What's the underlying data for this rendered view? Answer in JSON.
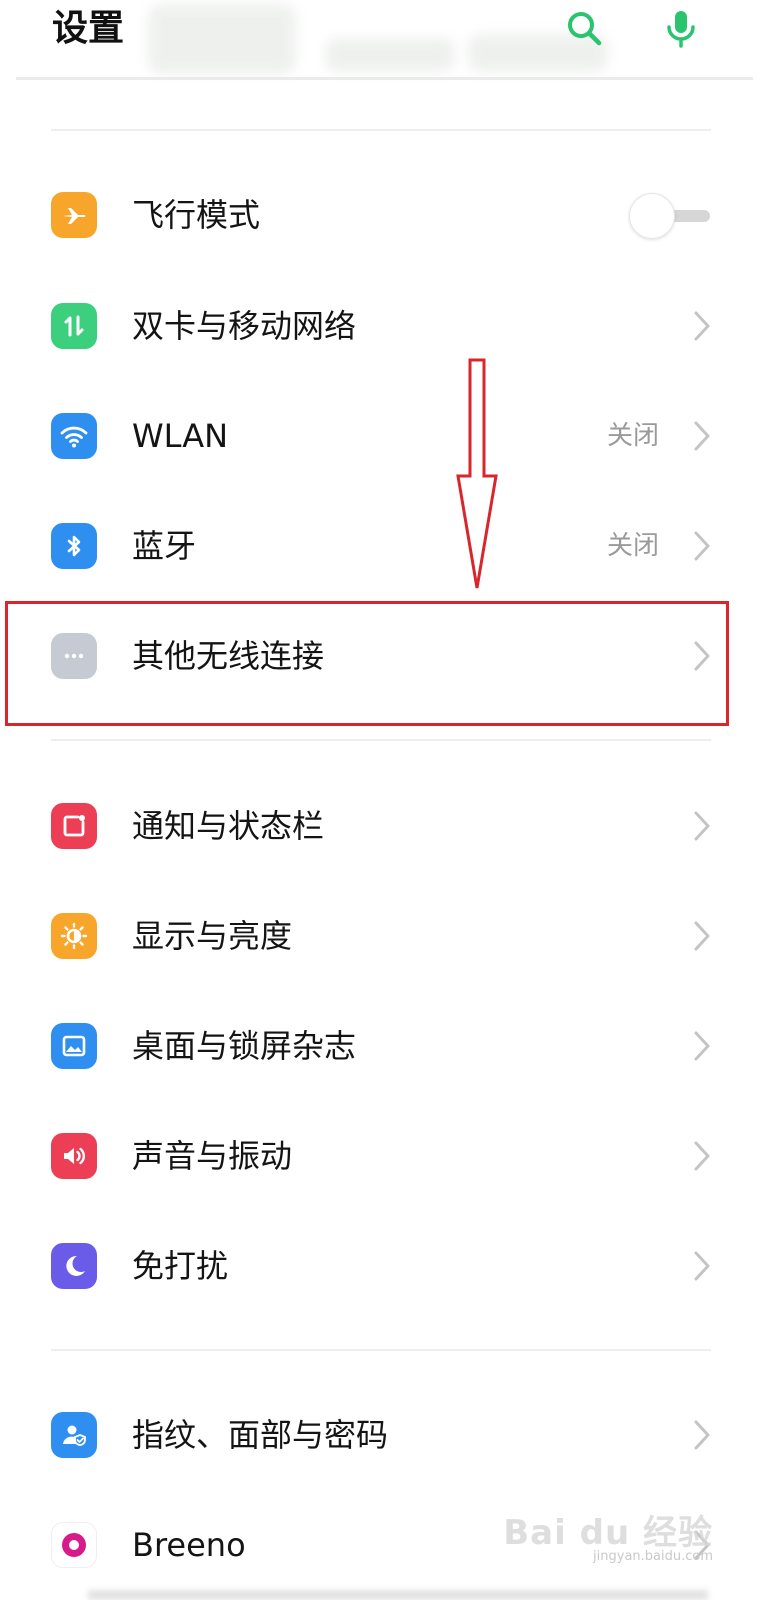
{
  "header": {
    "title": "设置",
    "search_icon": "search-icon",
    "mic_icon": "microphone-icon",
    "accent": "#2bc46e"
  },
  "settings": {
    "airplane": {
      "label": "飞行模式",
      "icon": "airplane-icon",
      "color": "#f7a52b",
      "toggle_on": false
    },
    "mobile_network": {
      "label": "双卡与移动网络",
      "icon": "swap-arrows-icon",
      "color": "#3ccf7e"
    },
    "wlan": {
      "label": "WLAN",
      "value": "关闭",
      "icon": "wifi-icon",
      "color": "#2f8ff0"
    },
    "bluetooth": {
      "label": "蓝牙",
      "value": "关闭",
      "icon": "bluetooth-icon",
      "color": "#2f8ff0"
    },
    "other_wireless": {
      "label": "其他无线连接",
      "icon": "more-dots-icon",
      "color": "#c6cad3"
    },
    "notifications": {
      "label": "通知与状态栏",
      "icon": "notification-icon",
      "color": "#ec3f55"
    },
    "display": {
      "label": "显示与亮度",
      "icon": "sun-icon",
      "color": "#f7a52b"
    },
    "wallpaper": {
      "label": "桌面与锁屏杂志",
      "icon": "picture-icon",
      "color": "#2f8ff0"
    },
    "sound": {
      "label": "声音与振动",
      "icon": "speaker-icon",
      "color": "#ec3f55"
    },
    "dnd": {
      "label": "免打扰",
      "icon": "moon-icon",
      "color": "#6a5ce8"
    },
    "fingerprint": {
      "label": "指纹、面部与密码",
      "icon": "user-shield-icon",
      "color": "#2f8ff0"
    },
    "breeno": {
      "label": "Breeno",
      "icon": "breeno-icon",
      "color": "#d81b8a"
    }
  },
  "annotation": {
    "highlight_color": "#d9262b"
  },
  "watermark": {
    "text": "Bai du 经验",
    "sub": "jingyan.baidu.com"
  }
}
